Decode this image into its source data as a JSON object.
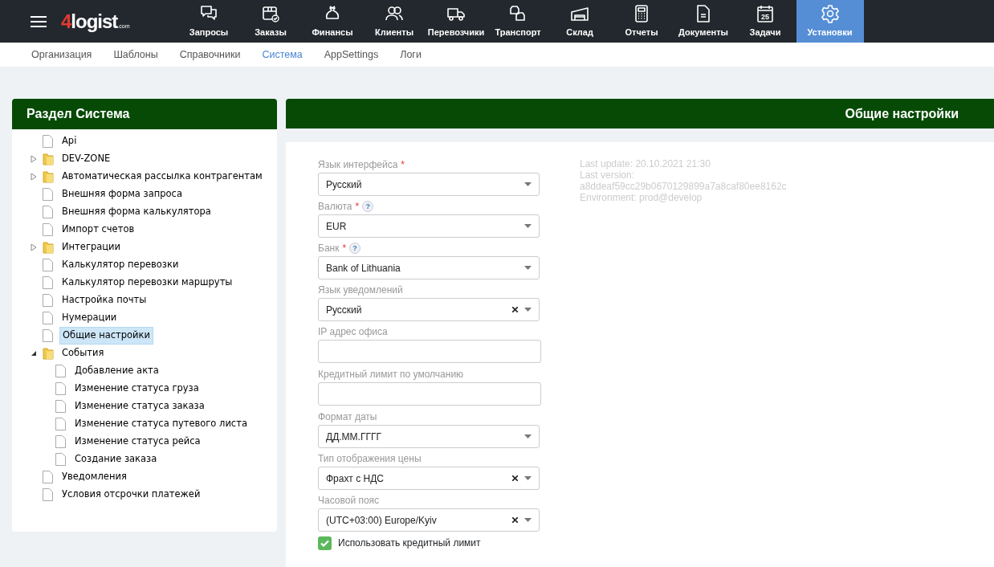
{
  "top_nav": {
    "logo": {
      "digit": "4",
      "word": "logist",
      "suffix": ".com"
    },
    "items": [
      {
        "label": "Запросы",
        "selected": false
      },
      {
        "label": "Заказы",
        "selected": false
      },
      {
        "label": "Финансы",
        "selected": false
      },
      {
        "label": "Клиенты",
        "selected": false
      },
      {
        "label": "Перевозчики",
        "selected": false
      },
      {
        "label": "Транспорт",
        "selected": false
      },
      {
        "label": "Склад",
        "selected": false
      },
      {
        "label": "Отчеты",
        "selected": false
      },
      {
        "label": "Документы",
        "selected": false
      },
      {
        "label": "Задачи",
        "selected": false,
        "icon_text": "25"
      },
      {
        "label": "Установки",
        "selected": true
      }
    ]
  },
  "sub_nav": [
    {
      "label": "Организация",
      "selected": false
    },
    {
      "label": "Шаблоны",
      "selected": false
    },
    {
      "label": "Справочники",
      "selected": false
    },
    {
      "label": "Система",
      "selected": true
    },
    {
      "label": "AppSettings",
      "selected": false
    },
    {
      "label": "Логи",
      "selected": false
    }
  ],
  "sidebar": {
    "title": "Раздел Система",
    "items": [
      {
        "label": "Api",
        "kind": "file",
        "selected": false
      },
      {
        "label": "DEV-ZONE",
        "kind": "folder",
        "expanded": false,
        "selected": false
      },
      {
        "label": "Автоматическая рассылка контрагентам",
        "kind": "folder",
        "expanded": false,
        "selected": false
      },
      {
        "label": "Внешняя форма запроса",
        "kind": "file",
        "selected": false
      },
      {
        "label": "Внешняя форма калькулятора",
        "kind": "file",
        "selected": false
      },
      {
        "label": "Импорт счетов",
        "kind": "file",
        "selected": false
      },
      {
        "label": "Интеграции",
        "kind": "folder",
        "expanded": false,
        "selected": false
      },
      {
        "label": "Калькулятор перевозки",
        "kind": "file",
        "selected": false
      },
      {
        "label": "Калькулятор перевозки маршруты",
        "kind": "file",
        "selected": false
      },
      {
        "label": "Настройка почты",
        "kind": "file",
        "selected": false
      },
      {
        "label": "Нумерации",
        "kind": "file",
        "selected": false
      },
      {
        "label": "Общие настройки",
        "kind": "file",
        "selected": true
      },
      {
        "label": "События",
        "kind": "folder",
        "expanded": true,
        "selected": false,
        "children": [
          {
            "label": "Добавление акта",
            "kind": "file",
            "selected": false
          },
          {
            "label": "Изменение статуса груза",
            "kind": "file",
            "selected": false
          },
          {
            "label": "Изменение статуса заказа",
            "kind": "file",
            "selected": false
          },
          {
            "label": "Изменение статуса путевого листа",
            "kind": "file",
            "selected": false
          },
          {
            "label": "Изменение статуса рейса",
            "kind": "file",
            "selected": false
          },
          {
            "label": "Создание заказа",
            "kind": "file",
            "selected": false
          }
        ]
      },
      {
        "label": "Уведомления",
        "kind": "file",
        "selected": false
      },
      {
        "label": "Условия отсрочки платежей",
        "kind": "file",
        "selected": false
      }
    ]
  },
  "panel": {
    "title": "Общие настройки",
    "fields": [
      {
        "label": "Язык интерфейса",
        "kind": "select",
        "required_mark": "*",
        "value": "Русский",
        "clearable": false
      },
      {
        "label": "Валюта",
        "kind": "select",
        "required_mark": "*",
        "help_text": "?",
        "value": "EUR",
        "clearable": false
      },
      {
        "label": "Банк",
        "kind": "select",
        "required_mark": "*",
        "help_text": "?",
        "value": "Bank of Lithuania",
        "clearable": false
      },
      {
        "label": "Язык уведомлений",
        "kind": "select",
        "value": "Русский",
        "clearable": true
      },
      {
        "label": "IP адрес офиса",
        "kind": "text"
      },
      {
        "label": "Кредитный лимит по умолчанию",
        "kind": "text"
      },
      {
        "label": "Формат даты",
        "kind": "select",
        "value": "ДД.ММ.ГГГГ",
        "clearable": false
      },
      {
        "label": "Тип отображения цены",
        "kind": "select",
        "value": "Фрахт с НДС",
        "clearable": true
      },
      {
        "label": "Часовой пояс",
        "kind": "select",
        "value": "(UTC+03:00) Europe/Kyiv",
        "clearable": true
      }
    ],
    "checkbox": {
      "label": "Использовать кредитный лимит",
      "checked": true
    },
    "info": [
      "Last update: 20.10.2021 21:30",
      "Last version:",
      "a8ddeaf59cc29b0670129899a7a8caf80ee8162c",
      "Environment: prod@develop"
    ]
  }
}
